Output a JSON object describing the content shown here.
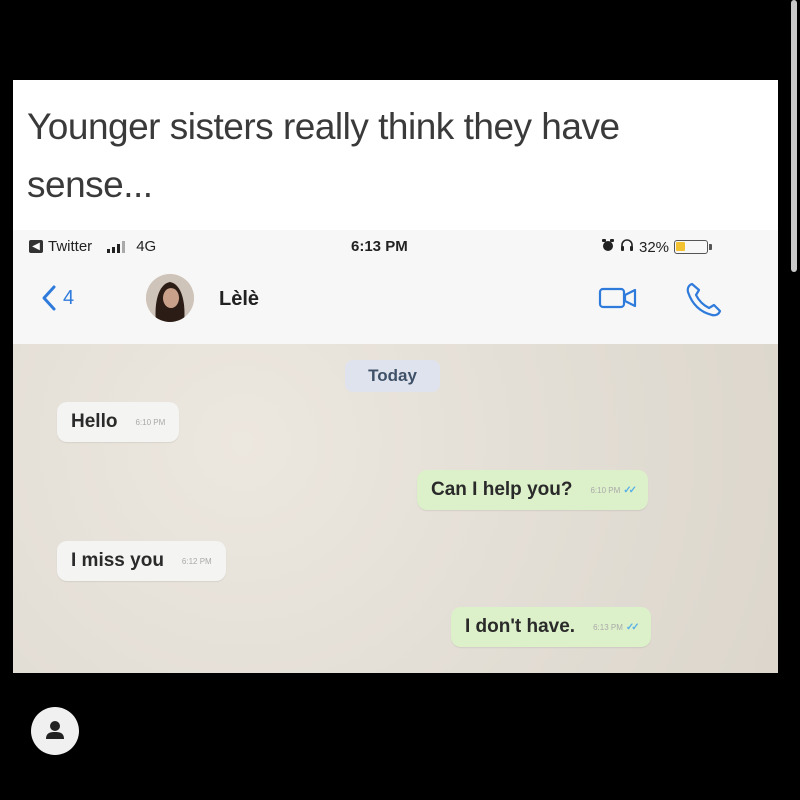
{
  "caption": {
    "line1": "Younger sisters really think they have",
    "line2": "sense..."
  },
  "status_bar": {
    "app_back": "Twitter",
    "network": "4G",
    "time": "6:13 PM",
    "battery": "32%"
  },
  "chat_header": {
    "back_count": "4",
    "contact_name": "Lèlè"
  },
  "chat": {
    "date_label": "Today",
    "messages": [
      {
        "direction": "incoming",
        "text": "Hello",
        "time": "6:10 PM",
        "status": ""
      },
      {
        "direction": "outgoing",
        "text": "Can I help you?",
        "time": "6:10 PM",
        "status": "read"
      },
      {
        "direction": "incoming",
        "text": "I miss you",
        "time": "6:12 PM",
        "status": ""
      },
      {
        "direction": "outgoing",
        "text": "I don't have.",
        "time": "6:13 PM",
        "status": "read"
      }
    ]
  },
  "icons": {
    "back": "chevron-left-icon",
    "video_call": "video-camera-icon",
    "voice_call": "phone-icon",
    "alarm": "alarm-icon",
    "headphones": "headphones-icon",
    "battery": "battery-icon",
    "signal": "signal-bars-icon",
    "user": "user-icon"
  },
  "colors": {
    "link_blue": "#2f7bdc",
    "outgoing_bubble": "#dcf1c9",
    "incoming_bubble": "#f4f4f2",
    "read_ticks": "#5ab0e6"
  }
}
